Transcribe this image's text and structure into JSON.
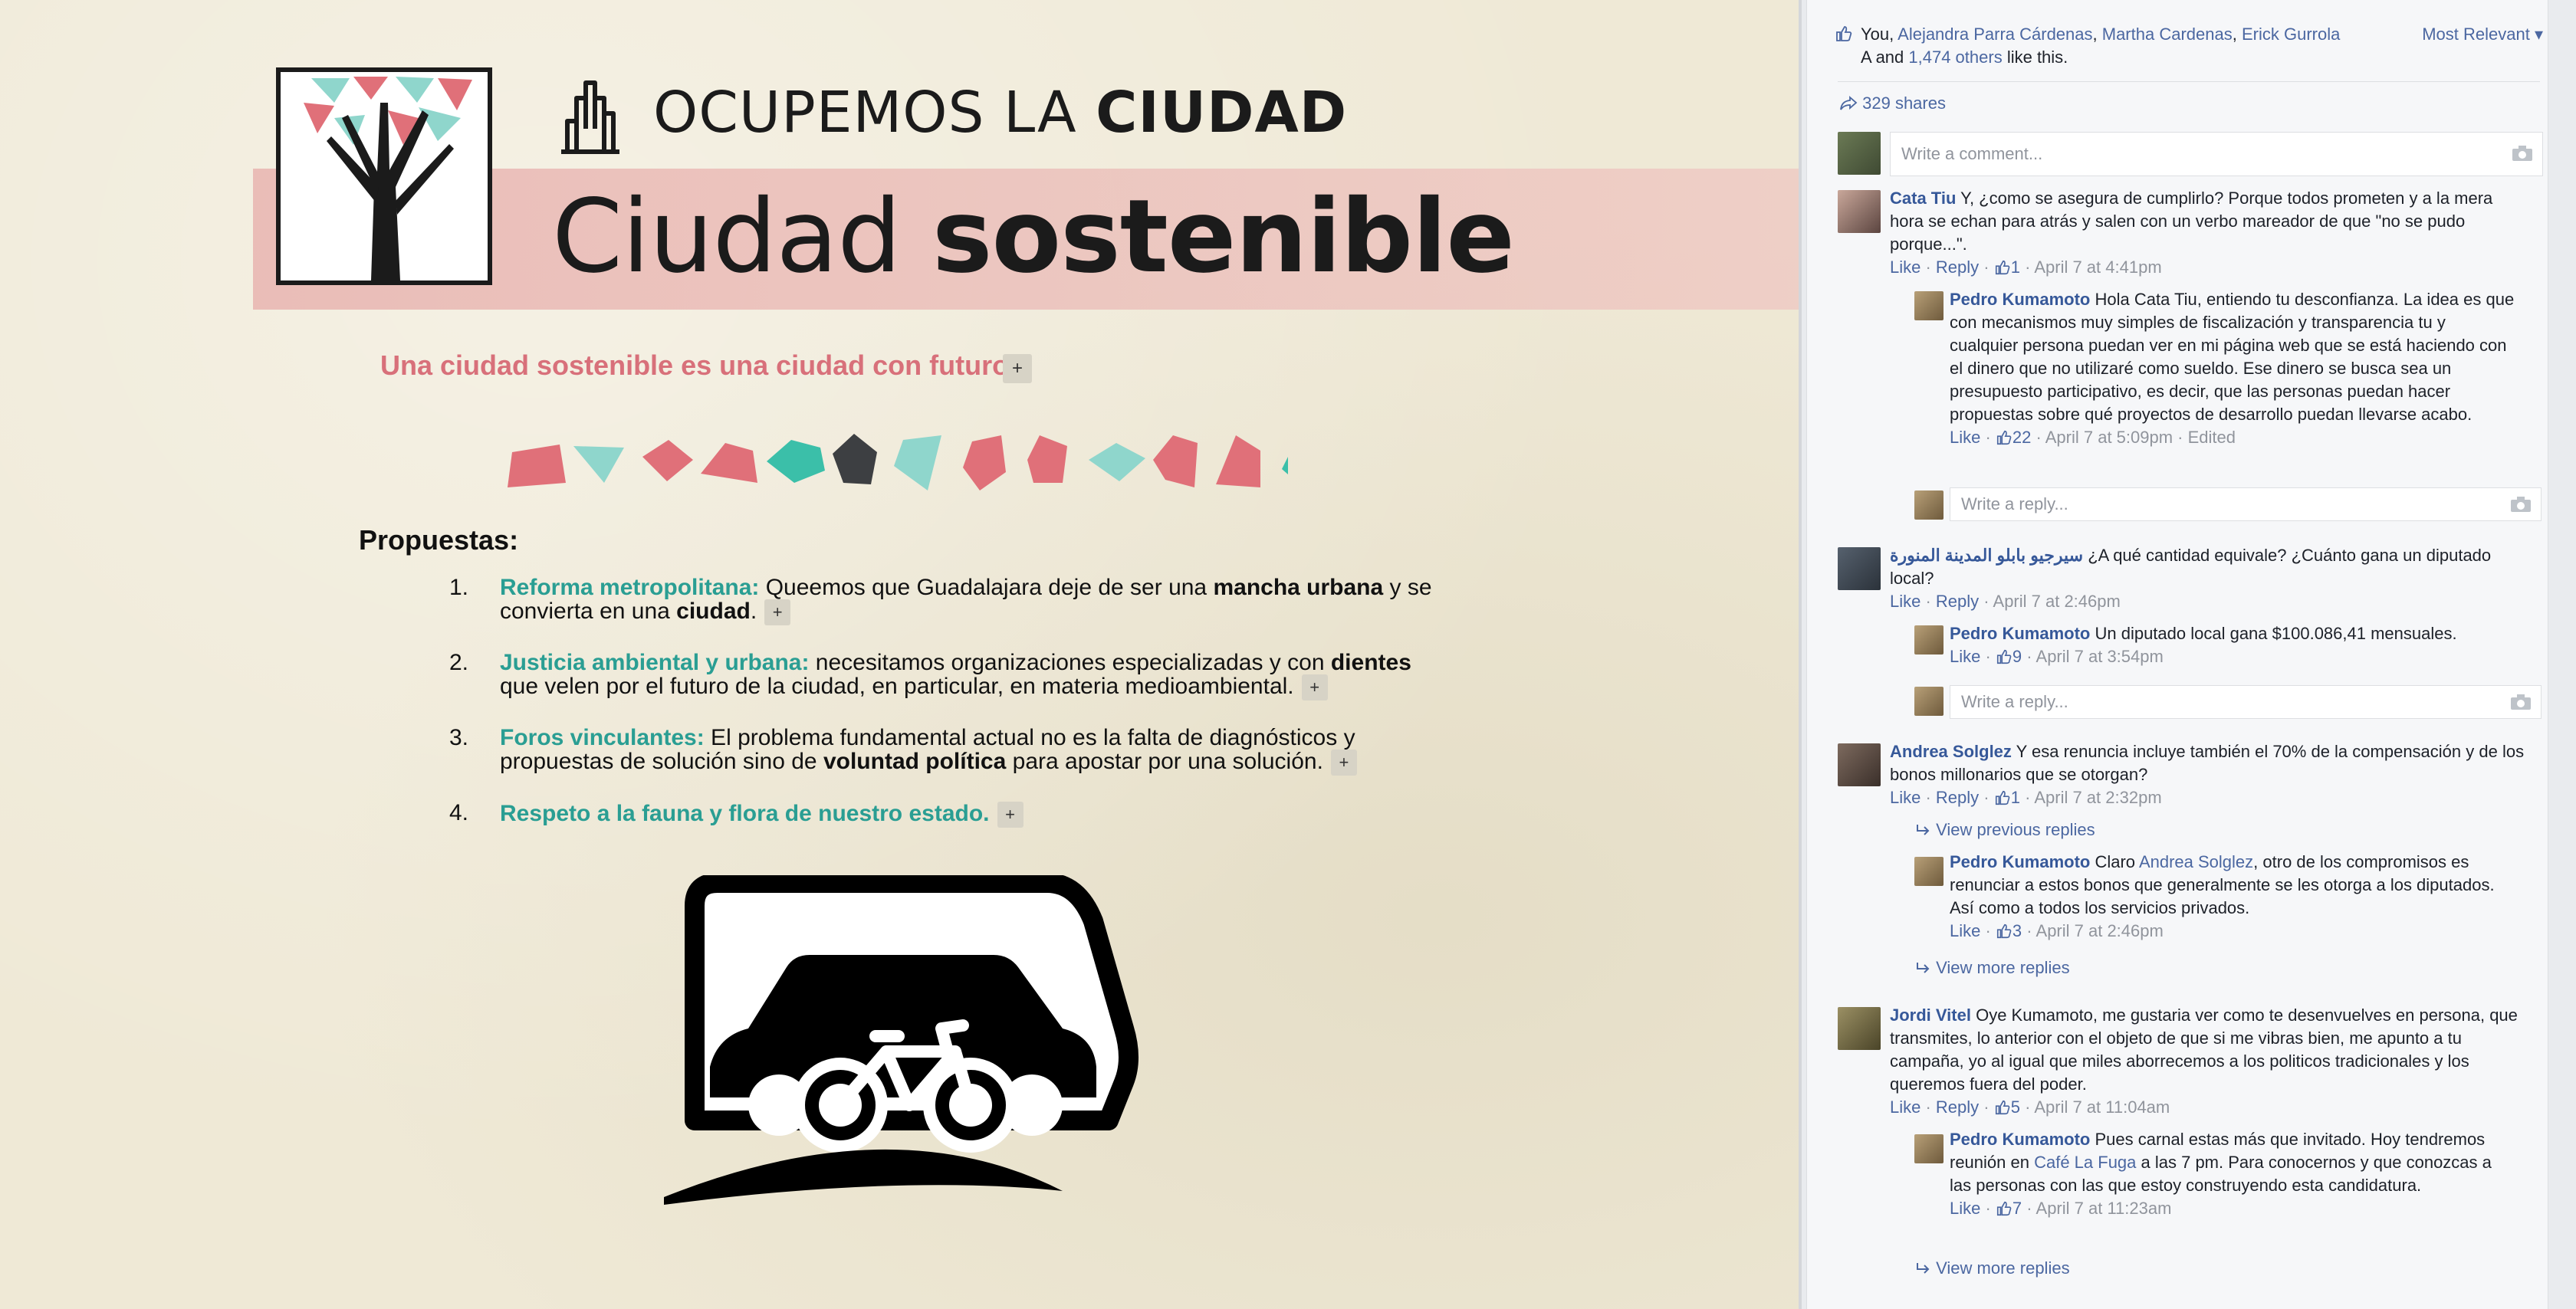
{
  "poster": {
    "brand_prefix": "OCUPEMOS LA ",
    "brand_strong": "CIUDAD",
    "title_light": "Ciudad ",
    "title_bold": "sostenible",
    "tagline": "Una ciudad sostenible es una ciudad con futuro.",
    "plus_label": "+",
    "proposals_heading": "Propuestas:",
    "colors": {
      "pink": "#e07079",
      "teal": "#3bbfa9",
      "light_teal": "#8fd6cc",
      "dark": "#3d3f42",
      "accent_text": "#2a9e93"
    },
    "shapes": [
      "pink",
      "light_teal",
      "pink",
      "pink",
      "teal",
      "dark",
      "light_teal",
      "pink",
      "pink",
      "light_teal",
      "pink",
      "pink",
      "teal"
    ],
    "proposals": [
      {
        "num": "1.",
        "head": "Reforma metropolitana:",
        "t1": " Queemos que Guadalajara deje de ser una ",
        "b1": "mancha urbana",
        "t2": " y se convierta en una ",
        "b2": "ciudad",
        "t3": "."
      },
      {
        "num": "2.",
        "head": "Justicia ambiental y urbana:",
        "t1": " necesitamos organizaciones especializadas y con ",
        "b1": "dientes",
        "t2": " que velen por el futuro de la ciudad, en particular, en materia medioambiental.",
        "b2": "",
        "t3": ""
      },
      {
        "num": "3.",
        "head": "Foros vinculantes:",
        "t1": " El problema fundamental actual no es la falta de diagnósticos y propuestas de solución sino de ",
        "b1": "voluntad política",
        "t2": " para apostar por una solución.",
        "b2": "",
        "t3": ""
      },
      {
        "num": "4.",
        "head": "Respeto a la fauna y flora de nuestro estado.",
        "t1": "",
        "b1": "",
        "t2": "",
        "b2": "",
        "t3": ""
      }
    ]
  },
  "sidebar": {
    "likes": {
      "you": "You, ",
      "names": [
        "Alejandra Parra Cárdenas",
        "Martha Cardenas",
        "Erick Gurrola"
      ],
      "line2_a": "A and ",
      "others": "1,474 others",
      "suffix": " like this.",
      "sort": "Most Relevant ▾"
    },
    "shares": "329 shares",
    "comment_placeholder": "Write a comment...",
    "reply_placeholder": "Write a reply...",
    "like": "Like",
    "reply": "Reply",
    "comments": [
      {
        "name": "Cata Tiu",
        "text": " Y, ¿como se asegura de cumplirlo? Porque todos prometen y a la mera hora se echan para atrás y salen con un verbo mareador de que \"no se pudo porque...\".",
        "likes": "1",
        "time": "April 7 at 4:41pm"
      },
      {
        "name": "Pedro Kumamoto",
        "text": " Hola Cata Tiu, entiendo tu desconfianza. La idea es que con mecanismos muy simples de fiscalización y transparencia tu y cualquier persona puedan ver en mi página web que se está haciendo con el dinero que no utilizaré como sueldo. Ese dinero se busca sea un presupuesto participativo, es decir, que las personas puedan hacer propuestas sobre qué proyectos de desarrollo puedan llevarse acabo.",
        "likes": "22",
        "time": "April 7 at 5:09pm · Edited"
      },
      {
        "name": "سيرجيو بابلو المدينة المنورة",
        "text": " ¿A qué cantidad equivale? ¿Cuánto gana un diputado local?",
        "time": "April 7 at 2:46pm"
      },
      {
        "name": "Pedro Kumamoto",
        "text": " Un diputado local gana $100.086,41 mensuales.",
        "likes": "9",
        "time": "April 7 at 3:54pm"
      },
      {
        "name": "Andrea Solglez",
        "text": " Y esa renuncia incluye también el 70% de la compensación y de los bonos millonarios que se otorgan?",
        "likes": "1",
        "time": "April 7 at 2:32pm"
      },
      {
        "name": "Pedro Kumamoto",
        "text_a": " Claro ",
        "mention": "Andrea Solglez",
        "text_b": ", otro de los compromisos es renunciar a estos bonos que generalmente se les otorga a los diputados. Así como a todos los servicios privados.",
        "likes": "3",
        "time": "April 7 at 2:46pm"
      },
      {
        "name": "Jordi Vitel",
        "text": " Oye Kumamoto, me gustaria ver como te desenvuelves en persona, que transmites, lo anterior con el objeto de que si me vibras bien, me apunto a tu campaña, yo al igual que miles aborrecemos a los politicos tradicionales y los queremos fuera del poder.",
        "likes": "5",
        "time": "April 7 at 11:04am"
      },
      {
        "name": "Pedro Kumamoto",
        "text_a": " Pues carnal estas más que invitado. Hoy tendremos reunión en ",
        "mention": "Café La Fuga",
        "text_b": " a las 7 pm. Para conocernos y que conozcas a las personas con las que estoy construyendo esta candidatura.",
        "likes": "7",
        "time": "April 7 at 11:23am"
      }
    ],
    "view_previous": "View previous replies",
    "view_more": "View more replies"
  }
}
